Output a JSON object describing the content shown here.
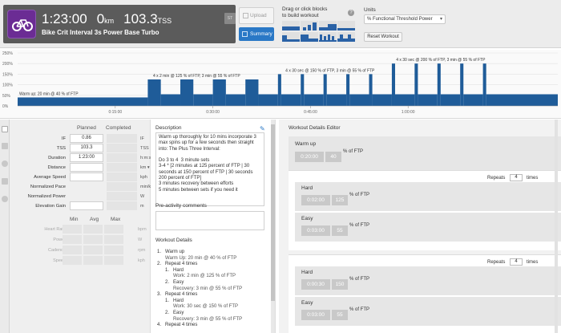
{
  "workout": {
    "duration": "1:23:00",
    "distance_value": "0",
    "distance_unit": "km",
    "tss_value": "103.3",
    "tss_unit": "TSS",
    "title": "Bike Crit Interval 3s Power Base Turbo",
    "badge": "ST"
  },
  "header": {
    "upload_label": "Upload",
    "summary_label": "Summary",
    "drag_label_line1": "Drag or click blocks",
    "drag_label_line2": "to build workout",
    "help": "?",
    "units_label": "Units",
    "units_value": "% Functional Threshold Power",
    "reset_label": "Reset Workout"
  },
  "chart_data": {
    "type": "area",
    "xlabel": "",
    "ylabel": "",
    "ylim": [
      0,
      250
    ],
    "xlim": [
      0,
      83
    ],
    "yticks": [
      "250%",
      "200%",
      "150%",
      "100%",
      "50%",
      "0%"
    ],
    "xticks": [
      "0:15:00",
      "0:30:00",
      "0:45:00",
      "1:00:00"
    ],
    "annotations": [
      "Warm up: 20 min @ 40 % of FTP",
      "4 x 2 min @ 125 % of FTP, 3 min @ 55 % of FTP",
      "4 x 30 sec @ 150 % of FTP, 3 min @ 55 % of FTP",
      "4 x 30 sec @ 200 % of FTP, 3 min @ 55 % of FTP"
    ],
    "series": [
      {
        "segments": [
          {
            "start": 0,
            "duration": 20,
            "value": 40
          },
          {
            "start": 20,
            "duration": 2,
            "value": 125
          },
          {
            "start": 22,
            "duration": 3,
            "value": 55
          },
          {
            "start": 25,
            "duration": 2,
            "value": 125
          },
          {
            "start": 27,
            "duration": 3,
            "value": 55
          },
          {
            "start": 30,
            "duration": 2,
            "value": 125
          },
          {
            "start": 32,
            "duration": 3,
            "value": 55
          },
          {
            "start": 35,
            "duration": 2,
            "value": 125
          },
          {
            "start": 37,
            "duration": 3,
            "value": 55
          },
          {
            "start": 40,
            "duration": 0.5,
            "value": 150
          },
          {
            "start": 40.5,
            "duration": 3,
            "value": 55
          },
          {
            "start": 43.5,
            "duration": 0.5,
            "value": 150
          },
          {
            "start": 44,
            "duration": 3,
            "value": 55
          },
          {
            "start": 47,
            "duration": 0.5,
            "value": 150
          },
          {
            "start": 47.5,
            "duration": 3,
            "value": 55
          },
          {
            "start": 50.5,
            "duration": 0.5,
            "value": 150
          },
          {
            "start": 51,
            "duration": 3,
            "value": 55
          },
          {
            "start": 54,
            "duration": 0.5,
            "value": 150
          },
          {
            "start": 54.5,
            "duration": 3,
            "value": 55
          },
          {
            "start": 57.5,
            "duration": 0.5,
            "value": 200
          },
          {
            "start": 58,
            "duration": 3,
            "value": 55
          },
          {
            "start": 61,
            "duration": 0.5,
            "value": 200
          },
          {
            "start": 61.5,
            "duration": 3,
            "value": 55
          },
          {
            "start": 64.5,
            "duration": 0.5,
            "value": 200
          },
          {
            "start": 65,
            "duration": 3,
            "value": 55
          },
          {
            "start": 68,
            "duration": 0.5,
            "value": 200
          },
          {
            "start": 68.5,
            "duration": 3,
            "value": 55
          },
          {
            "start": 71.5,
            "duration": 0.5,
            "value": 200
          },
          {
            "start": 72,
            "duration": 11,
            "value": 55
          }
        ]
      }
    ],
    "color": "#1f5c99",
    "grid": true
  },
  "stats": {
    "planned_header": "Planned",
    "completed_header": "Completed",
    "rows": [
      {
        "label": "IF",
        "planned": "0.86",
        "unit": "IF"
      },
      {
        "label": "TSS",
        "planned": "103.3",
        "unit": "TSS"
      },
      {
        "label": "Duration",
        "planned": "1:23:00",
        "unit": "h:m:s"
      },
      {
        "label": "Distance",
        "planned": "",
        "unit": "km  ▾"
      },
      {
        "label": "Average Speed",
        "planned": "",
        "unit": "kph"
      },
      {
        "label": "Normalized Pace",
        "planned": "",
        "unit": "min/km"
      },
      {
        "label": "Normalized Power",
        "planned": "",
        "unit": "W"
      },
      {
        "label": "Elevation Gain",
        "planned": "",
        "unit": "m"
      }
    ],
    "mam_headers": [
      "Min",
      "Avg",
      "Max"
    ],
    "mam_rows": [
      {
        "label": "Heart Rate",
        "unit": "bpm"
      },
      {
        "label": "Power",
        "unit": "W"
      },
      {
        "label": "Cadence",
        "unit": "rpm"
      },
      {
        "label": "Speed",
        "unit": "kph"
      }
    ]
  },
  "description": {
    "title": "Description",
    "text": "Warm up thoroughly for 10 mins incorporate 3 max spins up for a few seconds then straight into: The Plus Three Interval:\n\nDo 3 to 4  3 minute sets\n3-4 * [2 minutes at 125 percent of FTP | 30 seconds at 150 percent of FTP | 30 seconds 200 percent of FTP]\n3 minutes recovery between efforts\n5 minutes between sets if you need it",
    "pre_title": "Pre-activity comments",
    "details_title": "Workout Details",
    "details": [
      {
        "num": "1.",
        "text": "Warm up",
        "sub": "Warm Up: 20 min @ 40 % of FTP"
      },
      {
        "num": "2.",
        "text": "Repeat 4 times"
      },
      {
        "num": "1.",
        "text": "Hard",
        "sub": "Work: 2 min @ 125 % of FTP",
        "indent": true
      },
      {
        "num": "2.",
        "text": "Easy",
        "sub": "Recovery: 3 min @ 55 % of FTP",
        "indent": true
      },
      {
        "num": "3.",
        "text": "Repeat 4 times"
      },
      {
        "num": "1.",
        "text": "Hard",
        "sub": "Work: 30 sec @ 150 % of FTP",
        "indent": true
      },
      {
        "num": "2.",
        "text": "Easy",
        "sub": "Recovery: 3 min @ 55 % of FTP",
        "indent": true
      },
      {
        "num": "4.",
        "text": "Repeat 4 times"
      }
    ]
  },
  "editor": {
    "title": "Workout Details Editor",
    "pct_ftp": "% of FTP",
    "repeats_label": "Repeats",
    "times_label": "times",
    "warmup": {
      "name": "Warm up",
      "time": "0:20:00",
      "pct": "40"
    },
    "rep1": {
      "count": "4",
      "hard": {
        "name": "Hard",
        "time": "0:02:00",
        "pct": "125"
      },
      "easy": {
        "name": "Easy",
        "time": "0:03:00",
        "pct": "55"
      }
    },
    "rep2": {
      "count": "4",
      "hard": {
        "name": "Hard",
        "time": "0:00:30",
        "pct": "150"
      },
      "easy": {
        "name": "Easy",
        "time": "0:03:00",
        "pct": "55"
      }
    }
  }
}
